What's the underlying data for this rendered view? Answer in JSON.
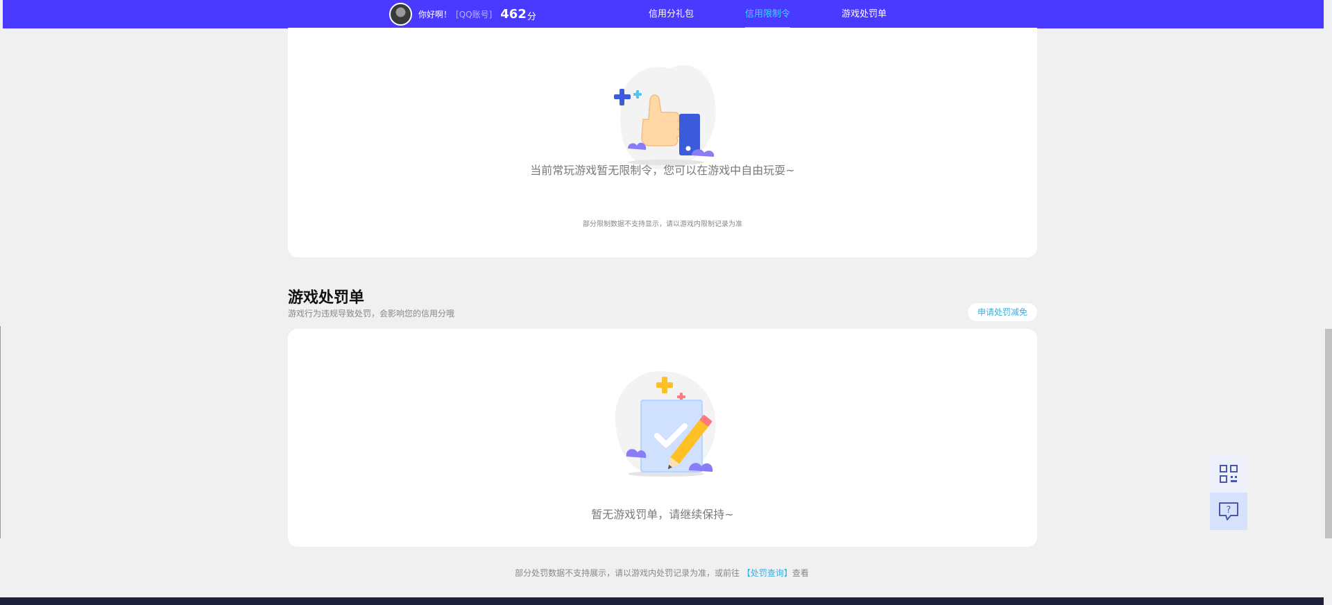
{
  "header": {
    "greeting": "你好啊！",
    "qq_label": "[QQ账号]",
    "score": "462",
    "score_unit": "分",
    "nav": [
      {
        "label": "信用分礼包",
        "active": false
      },
      {
        "label": "信用限制令",
        "active": true
      },
      {
        "label": "游戏处罚单",
        "active": false
      }
    ]
  },
  "restriction": {
    "message": "当前常玩游戏暂无限制令，您可以在游戏中自由玩耍~",
    "note": "部分限制数据不支持显示，请以游戏内限制记录为准"
  },
  "penalty": {
    "title": "游戏处罚单",
    "subtitle": "游戏行为违规导致处罚，会影响您的信用分哦",
    "apply_button": "申请处罚减免",
    "message": "暂无游戏罚单，请继续保持~"
  },
  "bottom_note": {
    "before": "部分处罚数据不支持展示，请以游戏内处罚记录为准，或前往",
    "link": "【处罚查询】",
    "after": "查看"
  },
  "colors": {
    "header_bg": "#4a3aff",
    "active_nav": "#3ad8ff",
    "link": "#3aaedd",
    "footer_bg": "#1e1f3b"
  },
  "icons": {
    "thumbs_up": "thumbs-up-illustration",
    "pencil_doc": "document-pencil-illustration",
    "qr": "qr-code-icon",
    "help": "help-chat-icon"
  }
}
